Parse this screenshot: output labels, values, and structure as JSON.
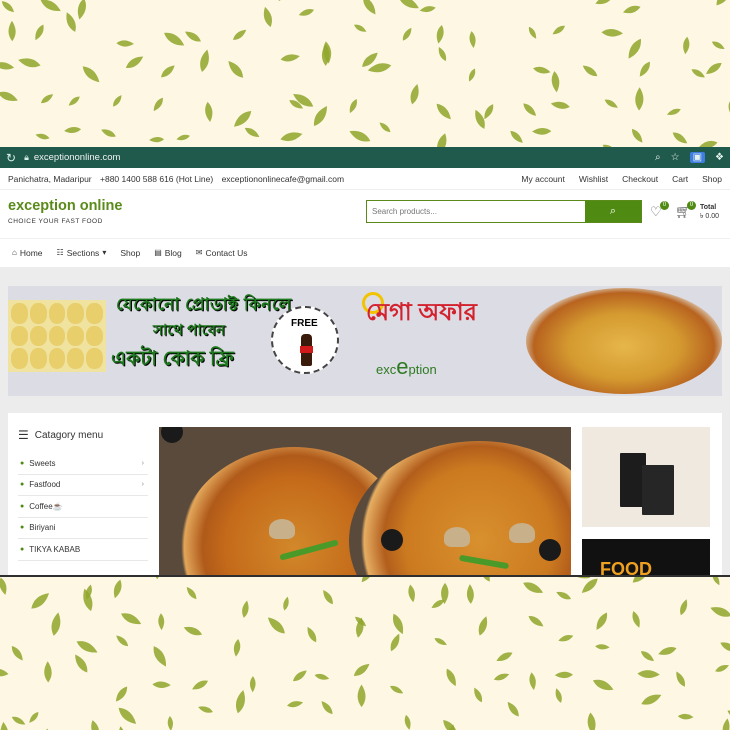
{
  "browser": {
    "url": "exceptiononline.com"
  },
  "topbar": {
    "location": "Panichatra, Madaripur",
    "phone": "+880 1400 588 616 (Hot Line)",
    "email": "exceptiononlinecafe@gmail.com",
    "links": [
      "My account",
      "Wishlist",
      "Checkout",
      "Cart",
      "Shop"
    ]
  },
  "header": {
    "site_title": "exception online",
    "tagline": "CHOICE YOUR FAST FOOD",
    "search_placeholder": "Search products...",
    "wishlist_count": "0",
    "cart_count": "0",
    "cart_total_label": "Total",
    "cart_total_value": "৳ 0.00"
  },
  "nav": {
    "home": "Home",
    "sections": "Sections",
    "shop": "Shop",
    "blog": "Blog",
    "contact": "Contact Us"
  },
  "banner": {
    "line1": "যেকোনো প্রোডাক্ট কিনলে",
    "line2": "সাথে পাবেন",
    "line3": "একটা কোক ফ্রি",
    "free": "FREE",
    "mega_offer": "মেগা অফার",
    "logo_prefix": "exc",
    "logo_e": "e",
    "logo_suffix": "ption"
  },
  "category_menu": {
    "title": "Catagory menu",
    "items": [
      {
        "label": "Sweets",
        "has_children": true
      },
      {
        "label": "Fastfood",
        "has_children": true
      },
      {
        "label": "Coffee☕",
        "has_children": false
      },
      {
        "label": "Biriyani",
        "has_children": false
      },
      {
        "label": "TIKYA KABAB",
        "has_children": false
      }
    ]
  },
  "side_promo": {
    "food_text": "FOOD"
  },
  "colors": {
    "brand_green": "#4f8a12",
    "chrome_bar": "#1f5a4c",
    "leaf_green": "#8fa62a",
    "background_cream": "#fdf7e3"
  }
}
